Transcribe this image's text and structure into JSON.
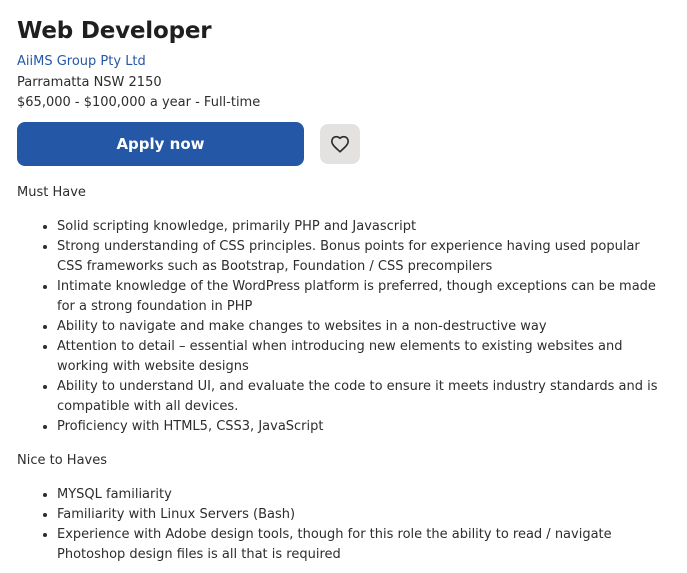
{
  "job": {
    "title": "Web Developer",
    "company": "AiiMS Group Pty Ltd",
    "location": "Parramatta NSW 2150",
    "salary_type": "$65,000 - $100,000 a year  - Full-time"
  },
  "actions": {
    "apply_label": "Apply now",
    "save_icon": "heart-icon"
  },
  "description": {
    "must_have_heading": "Must Have",
    "must_have": [
      "Solid scripting knowledge, primarily PHP and Javascript",
      "Strong understanding of CSS principles. Bonus points for experience having used popular CSS frameworks such as Bootstrap, Foundation / CSS precompilers",
      "Intimate knowledge of the WordPress platform is preferred, though exceptions can be made for a strong foundation in PHP",
      "Ability to navigate and make changes to websites in a non-destructive way",
      "Attention to detail – essential when introducing new elements to existing websites and working with website designs",
      "Ability to understand UI, and evaluate the code to ensure it meets industry standards and is compatible with all devices.",
      "Proficiency with HTML5, CSS3, JavaScript"
    ],
    "nice_heading": "Nice to Haves",
    "nice_to_have": [
      "MYSQL familiarity",
      "Familiarity with Linux Servers (Bash)",
      "Experience with Adobe design tools, though for this role the ability to read / navigate Photoshop design files is all that is required"
    ]
  },
  "colors": {
    "accent": "#2557a7",
    "save_bg": "#e4e2e0",
    "text": "#2d2d2d"
  }
}
